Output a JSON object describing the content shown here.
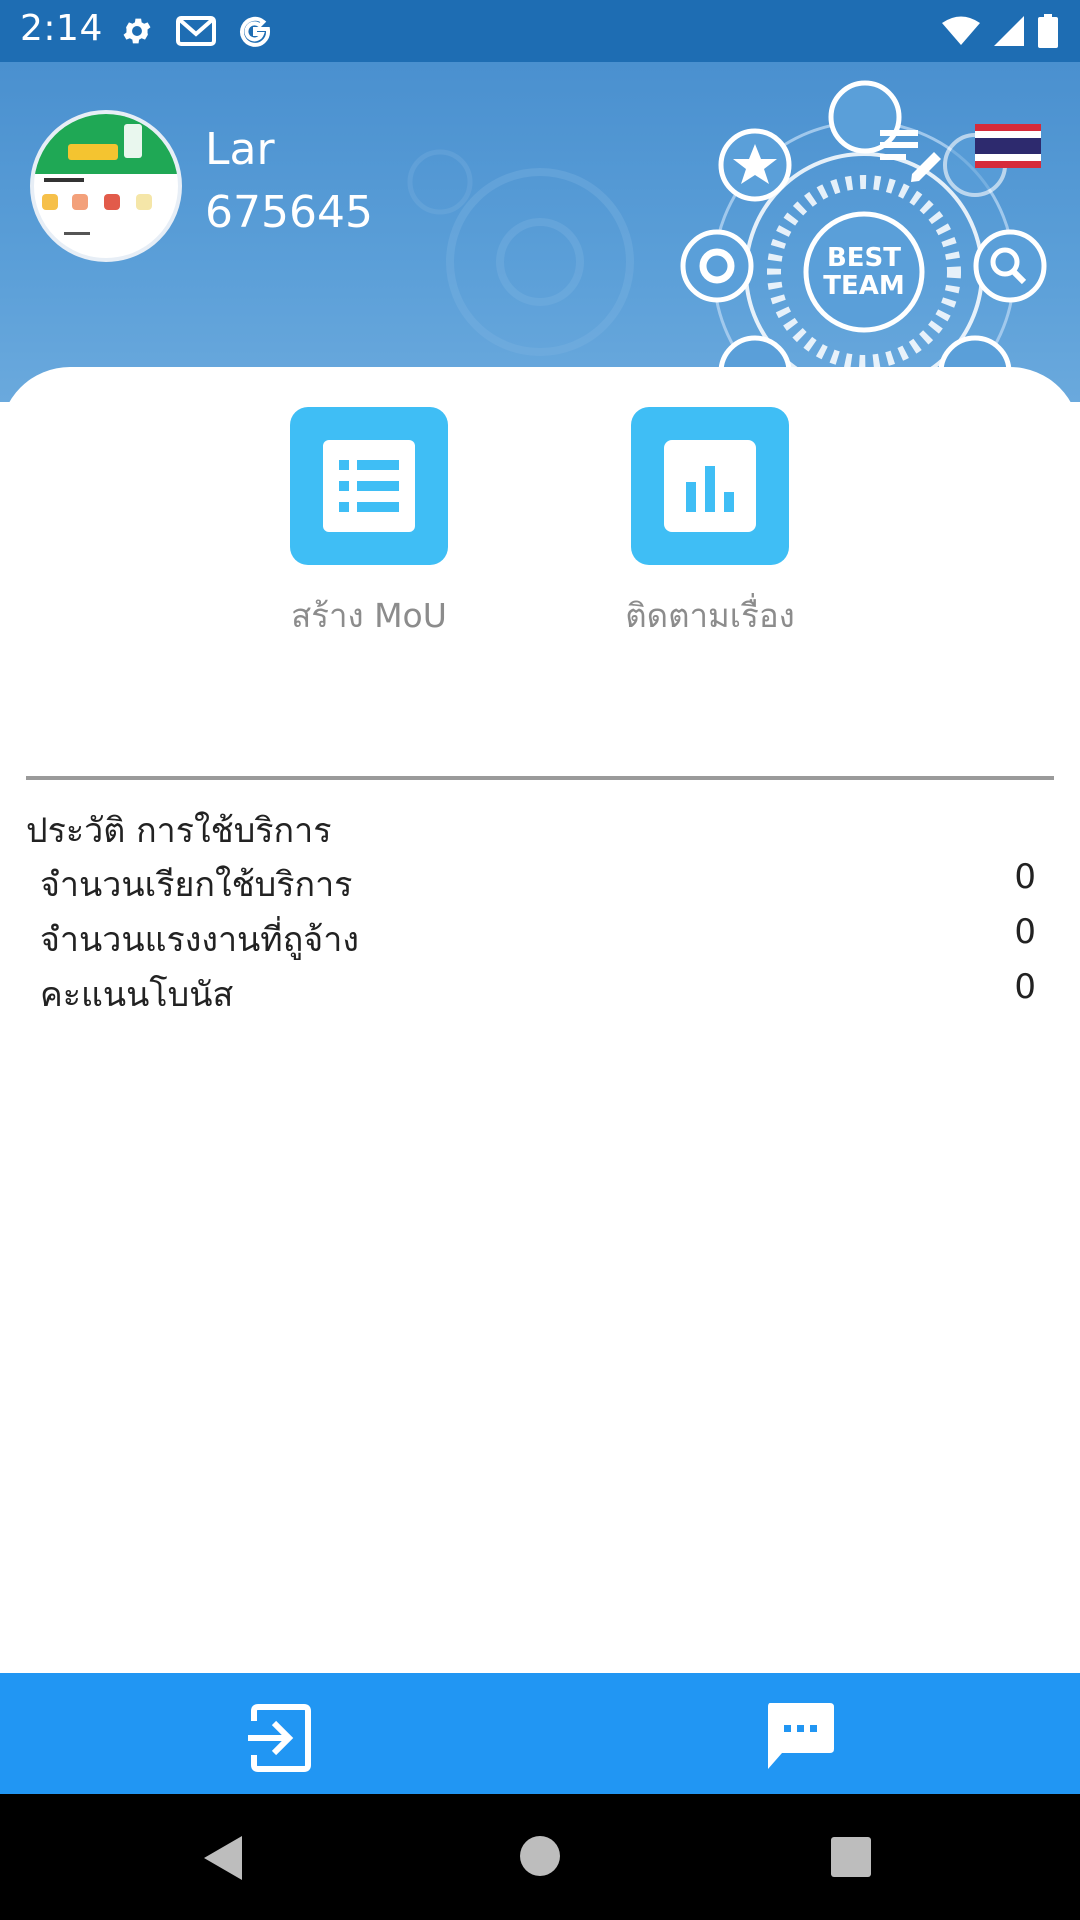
{
  "status_bar": {
    "time": "2:14",
    "left_icons": [
      "settings-icon",
      "gmail-icon",
      "google-icon"
    ],
    "right_icons": [
      "wifi-icon",
      "signal-icon",
      "battery-icon"
    ]
  },
  "header": {
    "user_name": "Lar",
    "user_id": "675645",
    "badge_text_line1": "BEST",
    "badge_text_line2": "TEAM"
  },
  "actions": [
    {
      "label": "สร้าง MoU",
      "icon": "list-icon"
    },
    {
      "label": "ติดตามเรื่อง",
      "icon": "bar-chart-icon"
    }
  ],
  "history": {
    "title": "ประวัติ การใช้บริการ",
    "rows": [
      {
        "label": "จำนวนเรียกใช้บริการ",
        "value": "0"
      },
      {
        "label": "จำนวนแรงงานที่ถูจ้าง",
        "value": "0"
      },
      {
        "label": "คะแนนโบนัส",
        "value": "0"
      }
    ]
  },
  "bottom_bar": {
    "left_icon": "logout-icon",
    "right_icon": "chat-icon",
    "color": "#2196f3"
  },
  "colors": {
    "status_bar": "#1e6db3",
    "header": "#5b9fd8",
    "accent_tile": "#3fbef5"
  }
}
